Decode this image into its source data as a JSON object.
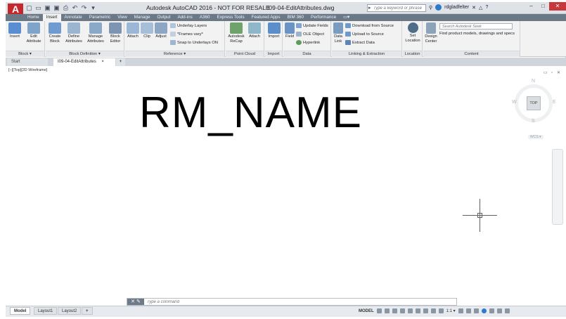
{
  "titlebar": {
    "app_title": "Autodesk AutoCAD 2016 - NOT FOR RESALE",
    "file_name": "I09-04-EditAttributes.dwg",
    "search_placeholder": "Type a keyword or phrase",
    "username": "rdgladfelter",
    "help": "?"
  },
  "ribbon_tabs": [
    "Home",
    "Insert",
    "Annotate",
    "Parametric",
    "View",
    "Manage",
    "Output",
    "Add-ins",
    "A360",
    "Express Tools",
    "Featured Apps",
    "BIM 360",
    "Performance"
  ],
  "active_tab": "Insert",
  "panels": {
    "block": {
      "title": "Block ▾",
      "insert": "Insert",
      "edit_attribute": "Edit Attribute"
    },
    "block_definition": {
      "title": "Block Definition ▾",
      "create_block": "Create Block",
      "define_attributes": "Define Attributes",
      "manage_attributes": "Manage Attributes",
      "block_editor": "Block Editor"
    },
    "reference": {
      "title": "Reference ▾",
      "attach": "Attach",
      "clip": "Clip",
      "adjust": "Adjust",
      "underlay_layers": "Underlay Layers",
      "frames_vary": "*Frames vary*",
      "snap_underlays": "Snap to Underlays ON"
    },
    "point_cloud": {
      "title": "Point Cloud",
      "autodesk_recap": "Autodesk ReCap",
      "attach": "Attach"
    },
    "import": {
      "title": "Import",
      "import": "Import"
    },
    "data": {
      "title": "Data",
      "field": "Field",
      "update_fields": "Update Fields",
      "ole_object": "OLE Object",
      "hyperlink": "Hyperlink"
    },
    "linking": {
      "title": "Linking & Extraction",
      "data_link": "Data Link",
      "download_source": "Download from Source",
      "upload_source": "Upload to Source",
      "extract_data": "Extract  Data"
    },
    "location": {
      "title": "Location",
      "set_location": "Set Location"
    },
    "content": {
      "title": "Content",
      "design_center": "Design Center",
      "search_placeholder": "Search Autodesk Seek",
      "find_text": "Find product models, drawings and specs"
    }
  },
  "doc_tabs": {
    "start": "Start",
    "file": "I09-04-EditAttributes",
    "close": "×",
    "new": "+"
  },
  "viewport_label": "[−][Top][2D Wireframe]",
  "viewport_controls": "▭ ▫ ✕",
  "drawing_text": "RM_NAME",
  "viewcube": {
    "top": "TOP",
    "n": "N",
    "s": "S",
    "e": "E",
    "w": "W",
    "wcs": "WCS ▾"
  },
  "command_line": {
    "placeholder": "Type a command",
    "ctrl": "✕ ✎"
  },
  "layout_tabs": {
    "model": "Model",
    "layout1": "Layout1",
    "layout2": "Layout2",
    "add": "+"
  },
  "status": {
    "model": "MODEL",
    "scale": "1:1 ▾"
  }
}
